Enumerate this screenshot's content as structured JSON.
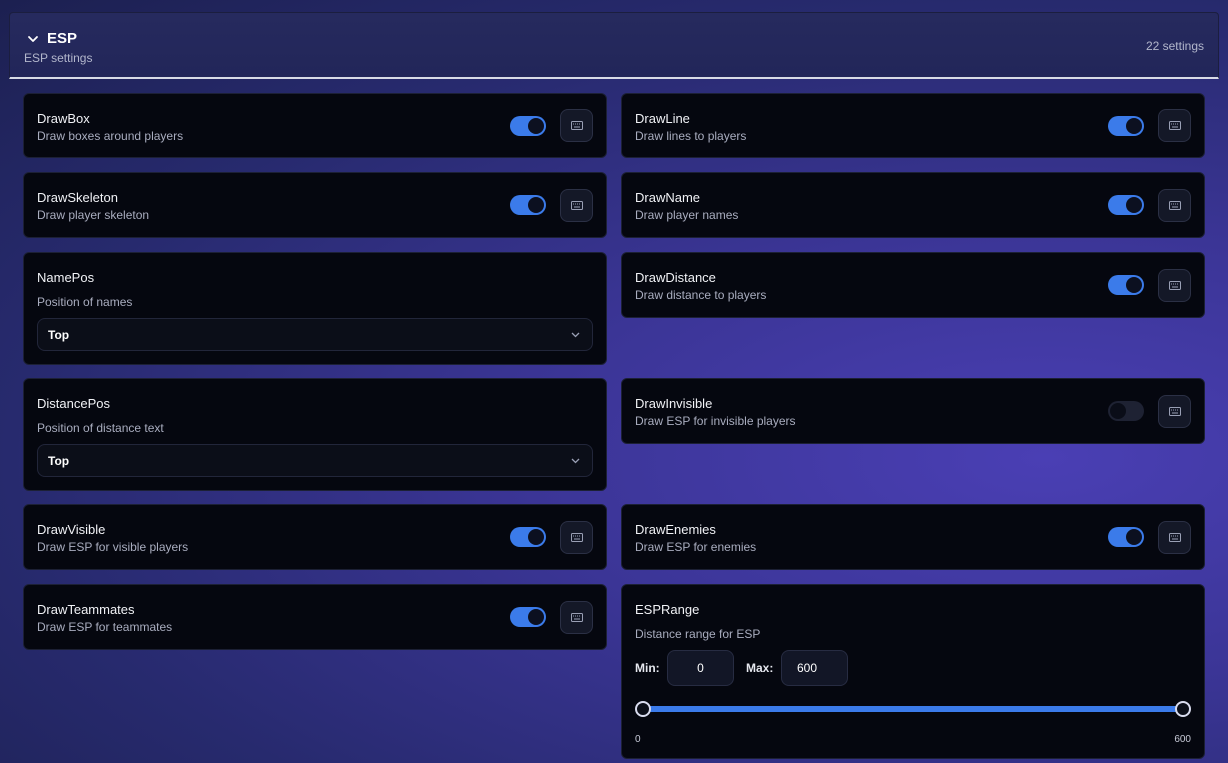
{
  "header": {
    "title": "ESP",
    "subtitle": "ESP settings",
    "count": "22 settings"
  },
  "cards": {
    "drawbox": {
      "name": "DrawBox",
      "desc": "Draw boxes around players",
      "enabled": true
    },
    "drawline": {
      "name": "DrawLine",
      "desc": "Draw lines to players",
      "enabled": true
    },
    "drawskeleton": {
      "name": "DrawSkeleton",
      "desc": "Draw player skeleton",
      "enabled": true
    },
    "drawname": {
      "name": "DrawName",
      "desc": "Draw player names",
      "enabled": true
    },
    "namepos": {
      "name": "NamePos",
      "desc": "Position of names",
      "value": "Top"
    },
    "drawdistance": {
      "name": "DrawDistance",
      "desc": "Draw distance to players",
      "enabled": true
    },
    "distancepos": {
      "name": "DistancePos",
      "desc": "Position of distance text",
      "value": "Top"
    },
    "drawinvisible": {
      "name": "DrawInvisible",
      "desc": "Draw ESP for invisible players",
      "enabled": false
    },
    "drawvisible": {
      "name": "DrawVisible",
      "desc": "Draw ESP for visible players",
      "enabled": true
    },
    "drawenemies": {
      "name": "DrawEnemies",
      "desc": "Draw ESP for enemies",
      "enabled": true
    },
    "drawteammates": {
      "name": "DrawTeammates",
      "desc": "Draw ESP for teammates",
      "enabled": true
    },
    "esprange": {
      "name": "ESPRange",
      "desc": "Distance range for ESP",
      "min_label": "Min:",
      "max_label": "Max:",
      "min_value": "0",
      "max_value": "600",
      "range_start": "0",
      "range_end": "600"
    }
  },
  "icons": {
    "collapse": "chevron-down-icon",
    "keybind": "keyboard-icon",
    "select": "chevron-down-icon"
  },
  "colors": {
    "accent": "#3b7bea",
    "card_bg": "#05070f",
    "header_bg": "#262a5e"
  }
}
